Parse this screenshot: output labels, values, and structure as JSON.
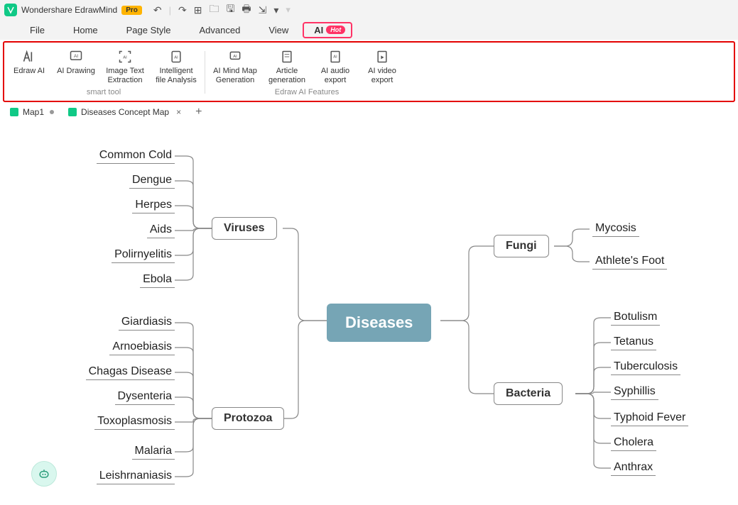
{
  "app": {
    "title": "Wondershare EdrawMind",
    "pro": "Pro"
  },
  "qat": {
    "undo": "↶",
    "redo": "↷",
    "add": "⊞",
    "folder": "🗀",
    "save": "🖫",
    "print": "🖶",
    "export": "⇲",
    "dd": "▾"
  },
  "menu": {
    "file": "File",
    "home": "Home",
    "page_style": "Page Style",
    "advanced": "Advanced",
    "view": "View",
    "ai": "AI",
    "hot": "Hot"
  },
  "ribbon": {
    "group1_caption": "smart tool",
    "group2_caption": "Edraw AI Features",
    "edraw_ai": "Edraw AI",
    "ai_drawing": "AI Drawing",
    "img_text": "Image Text Extraction",
    "file_analysis": "Intelligent file Analysis",
    "mindmap_gen": "AI Mind Map Generation",
    "article_gen": "Article generation",
    "audio_export": "AI audio export",
    "video_export": "AI video export"
  },
  "tabs": {
    "map1": "Map1",
    "doc": "Diseases Concept Map"
  },
  "mindmap": {
    "root": "Diseases",
    "viruses": {
      "label": "Viruses",
      "children": [
        "Common Cold",
        "Dengue",
        "Herpes",
        "Aids",
        "Polirnyelitis",
        "Ebola"
      ]
    },
    "protozoa": {
      "label": "Protozoa",
      "children": [
        "Giardiasis",
        "Arnoebiasis",
        "Chagas Disease",
        "Dysentеria",
        "Toxoplasmosis",
        "Malaria",
        "Leishrnaniasis"
      ]
    },
    "fungi": {
      "label": "Fungi",
      "children": [
        "Mycosis",
        "Athlete's Foot"
      ]
    },
    "bacteria": {
      "label": "Bacteria",
      "children": [
        "Botulism",
        "Tetanus",
        "Tuberculosis",
        "Syphillis",
        "Typhoid Fever",
        "Cholera",
        "Anthrax"
      ]
    }
  }
}
